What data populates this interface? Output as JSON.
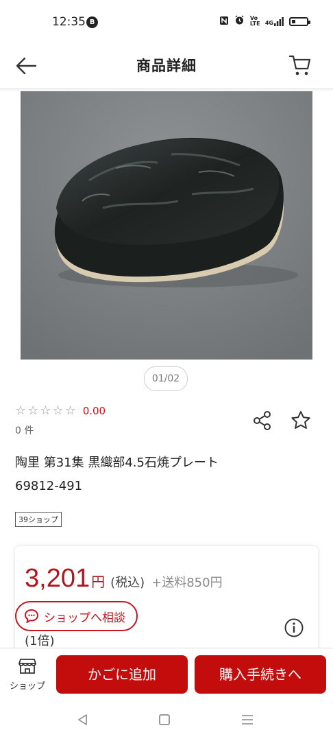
{
  "status": {
    "time": "12:35",
    "notif_badge": "B",
    "icons": [
      "nfc-icon",
      "alarm-icon",
      "volte-icon",
      "signal-icon",
      "battery-icon"
    ],
    "volte_text": "Vo LTE",
    "network_text": "4G",
    "battery_level": 0.25
  },
  "header": {
    "title": "商品詳細"
  },
  "gallery": {
    "counter": "01/02"
  },
  "rating": {
    "stars_filled": 0,
    "value": "0.00",
    "count": "0 件"
  },
  "product": {
    "name": "陶里 第31集 黒織部4.5石焼プレート",
    "code": "69812-491",
    "shop_tag": "39ショップ"
  },
  "price": {
    "value": "3,201",
    "yen": "円",
    "tax": "(税込)",
    "shipping": "+送料850円",
    "multiplier": "(1倍)"
  },
  "consult": {
    "label": "ショップへ相談"
  },
  "bottom": {
    "shop_label": "ショップ",
    "add_cart": "かごに追加",
    "checkout": "購入手続きへ"
  },
  "colors": {
    "accent": "#c30d0d",
    "price": "#b3151d"
  }
}
